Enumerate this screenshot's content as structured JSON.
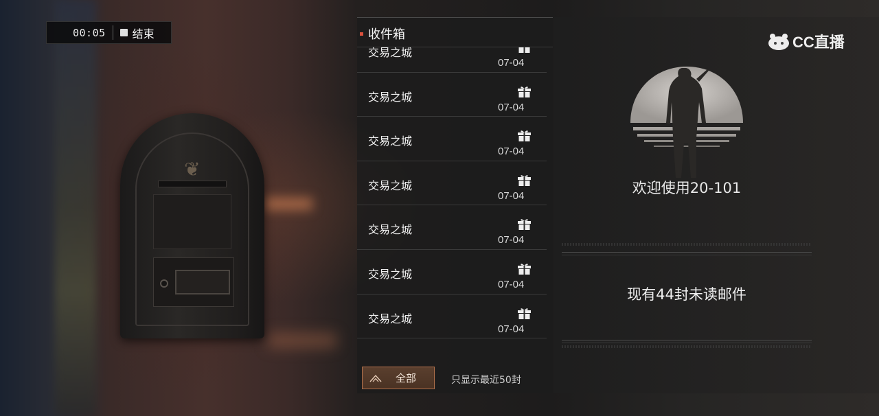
{
  "timer": {
    "time": "00:05",
    "end_label": "结束"
  },
  "inbox": {
    "title": "收件箱",
    "mails": [
      {
        "sender": "交易之城",
        "date": "07-04"
      },
      {
        "sender": "交易之城",
        "date": "07-04"
      },
      {
        "sender": "交易之城",
        "date": "07-04"
      },
      {
        "sender": "交易之城",
        "date": "07-04"
      },
      {
        "sender": "交易之城",
        "date": "07-04"
      },
      {
        "sender": "交易之城",
        "date": "07-04"
      },
      {
        "sender": "交易之城",
        "date": "07-04"
      }
    ],
    "filter_label": "全部",
    "note": "只显示最近50封"
  },
  "preview": {
    "welcome": "欢迎使用20-101",
    "unread": "现有44封未读邮件"
  },
  "watermark": {
    "text": "CC直播"
  },
  "colors": {
    "accent": "#b2714b",
    "dot": "#d9503c"
  }
}
